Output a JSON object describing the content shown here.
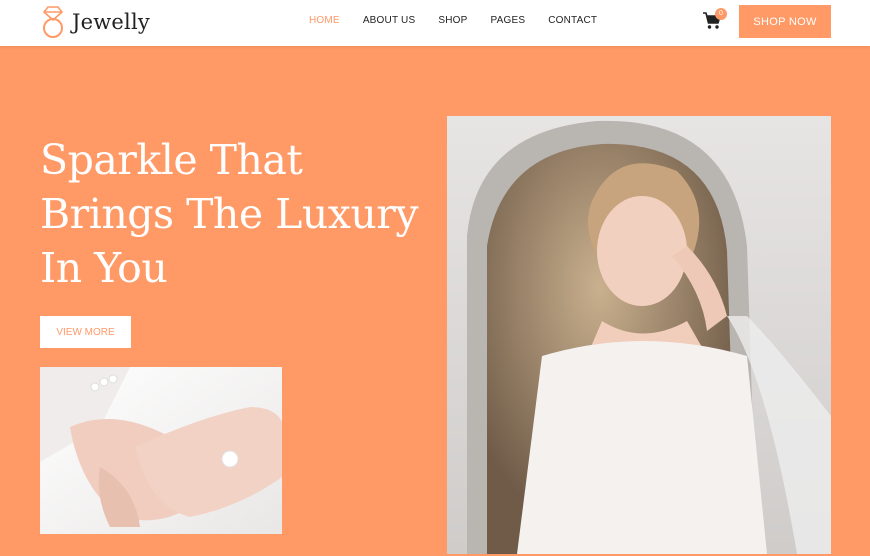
{
  "brand": {
    "name": "Jewelly",
    "icon": "diamond-ring-icon",
    "accent": "#ff9966"
  },
  "nav": {
    "items": [
      {
        "label": "HOME",
        "active": true
      },
      {
        "label": "ABOUT US",
        "active": false
      },
      {
        "label": "SHOP",
        "active": false
      },
      {
        "label": "PAGES",
        "active": false
      },
      {
        "label": "CONTACT",
        "active": false
      }
    ]
  },
  "cart": {
    "icon": "shopping-cart-icon",
    "count": "0"
  },
  "header": {
    "cta_label": "SHOP NOW"
  },
  "hero": {
    "title_line1": "Sparkle That",
    "title_line2": "Brings The Luxury",
    "title_line3": "In You",
    "button_label": "VIEW MORE"
  },
  "images": {
    "small": "hands-with-diamond-ring-photo",
    "large": "bride-in-mirror-with-earrings-photo"
  }
}
